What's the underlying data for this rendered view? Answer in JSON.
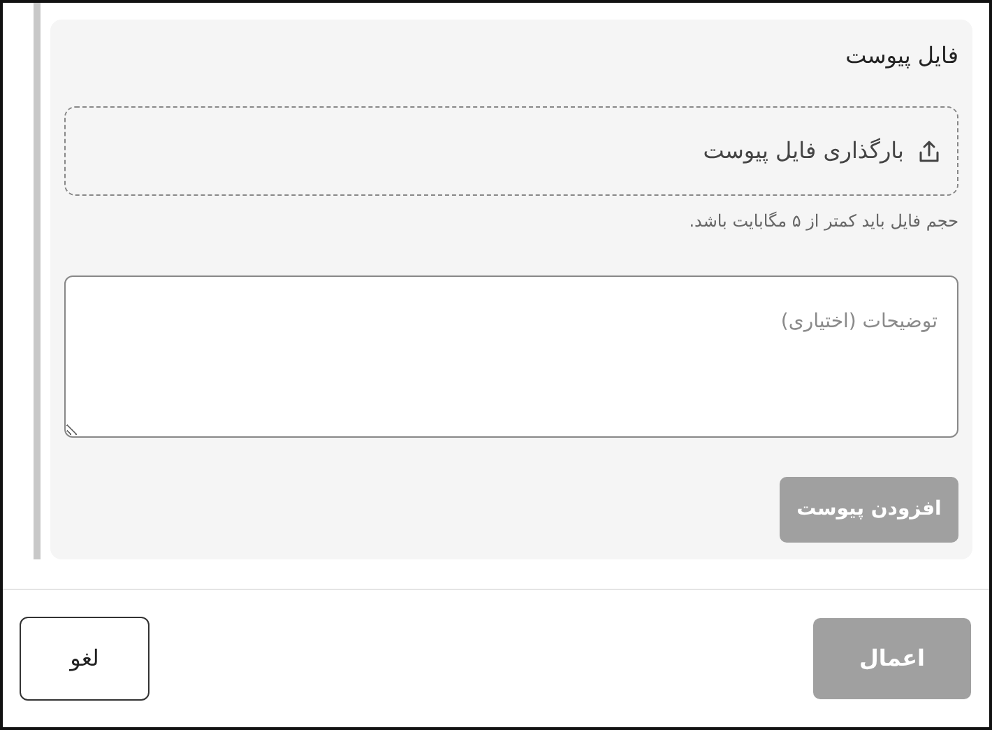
{
  "attachment": {
    "title": "فایل پیوست",
    "upload": {
      "label": "بارگذاری فایل پیوست"
    },
    "hint": "حجم فایل باید کمتر از ۵ مگابایت باشد.",
    "description": {
      "placeholder": "توضیحات (اختیاری)"
    },
    "add_button": {
      "label": "افزودن پیوست",
      "disabled": true
    }
  },
  "footer": {
    "buttons": [
      {
        "label": "اعمال",
        "kind": "primary",
        "disabled": true
      },
      {
        "label": "لغو",
        "kind": "outline",
        "disabled": false
      }
    ]
  }
}
